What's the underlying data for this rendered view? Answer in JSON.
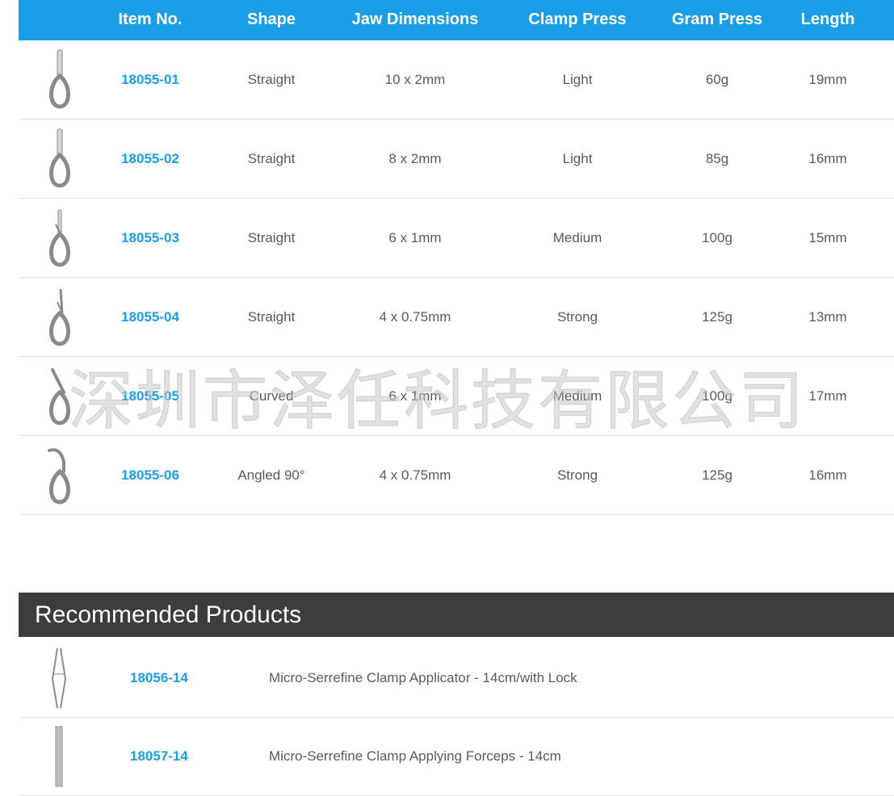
{
  "table": {
    "headers": [
      "Item No.",
      "Shape",
      "Jaw Dimensions",
      "Clamp Press",
      "Gram Press",
      "Length"
    ],
    "rows": [
      {
        "item": "18055-01",
        "shape": "Straight",
        "jaw": "10 x 2mm",
        "clamp": "Light",
        "gram": "60g",
        "length": "19mm"
      },
      {
        "item": "18055-02",
        "shape": "Straight",
        "jaw": "8 x 2mm",
        "clamp": "Light",
        "gram": "85g",
        "length": "16mm"
      },
      {
        "item": "18055-03",
        "shape": "Straight",
        "jaw": "6 x 1mm",
        "clamp": "Medium",
        "gram": "100g",
        "length": "15mm"
      },
      {
        "item": "18055-04",
        "shape": "Straight",
        "jaw": "4 x 0.75mm",
        "clamp": "Strong",
        "gram": "125g",
        "length": "13mm"
      },
      {
        "item": "18055-05",
        "shape": "Curved",
        "jaw": "6 x 1mm",
        "clamp": "Medium",
        "gram": "100g",
        "length": "17mm"
      },
      {
        "item": "18055-06",
        "shape": "Angled 90°",
        "jaw": "4 x 0.75mm",
        "clamp": "Strong",
        "gram": "125g",
        "length": "16mm"
      }
    ]
  },
  "recommended": {
    "title": "Recommended Products",
    "items": [
      {
        "item": "18056-14",
        "description": "Micro-Serrefine Clamp Applicator - 14cm/with Lock"
      },
      {
        "item": "18057-14",
        "description": "Micro-Serrefine Clamp Applying Forceps - 14cm"
      }
    ]
  },
  "watermark": "深圳市泽任科技有限公司",
  "colors": {
    "header_bg": "#1a9ee8",
    "link": "#1a9ee8",
    "section_bg": "#3d3d3d"
  }
}
